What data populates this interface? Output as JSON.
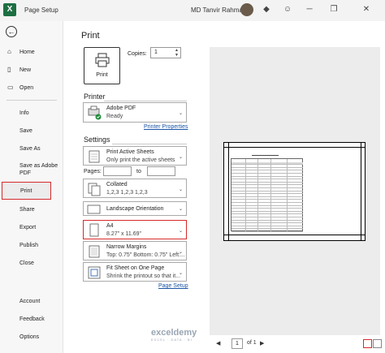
{
  "titlebar": {
    "app_icon": "X",
    "title": "Page Setup",
    "user": "MD Tanvir Rahman"
  },
  "sidebar": {
    "back_icon": "back-arrow-icon",
    "items": [
      {
        "label": "Home",
        "icon": "home-icon"
      },
      {
        "label": "New",
        "icon": "new-icon"
      },
      {
        "label": "Open",
        "icon": "open-folder-icon"
      },
      {
        "label": "Info"
      },
      {
        "label": "Save"
      },
      {
        "label": "Save As"
      },
      {
        "label": "Save as Adobe PDF"
      },
      {
        "label": "Print"
      },
      {
        "label": "Share"
      },
      {
        "label": "Export"
      },
      {
        "label": "Publish"
      },
      {
        "label": "Close"
      },
      {
        "label": "Account"
      },
      {
        "label": "Feedback"
      },
      {
        "label": "Options"
      }
    ],
    "active": "Print"
  },
  "main": {
    "heading": "Print",
    "print_button": "Print",
    "copies_label": "Copies:",
    "copies_value": "1",
    "printer_heading": "Printer",
    "printer_name": "Adobe PDF",
    "printer_status": "Ready",
    "printer_properties": "Printer Properties",
    "settings_heading": "Settings",
    "print_what": {
      "title": "Print Active Sheets",
      "subtitle": "Only print the active sheets"
    },
    "pages_label": "Pages:",
    "pages_to": "to",
    "collated": {
      "title": "Collated",
      "subtitle": "1,2,3    1,2,3    1,2,3"
    },
    "orientation": {
      "title": "Landscape Orientation"
    },
    "paper": {
      "title": "A4",
      "subtitle": "8.27\" x 11.69\""
    },
    "margins": {
      "title": "Narrow Margins",
      "subtitle": "Top: 0.75\" Bottom: 0.75\" Left:..."
    },
    "scaling": {
      "title": "Fit Sheet on One Page",
      "subtitle": "Shrink the printout so that it..."
    },
    "page_setup": "Page Setup"
  },
  "preview": {
    "current_page": "1",
    "of_label": "of 1"
  },
  "watermark": {
    "name": "exceldemy",
    "tagline": "EXCEL · DATA · BI"
  },
  "colors": {
    "highlight": "#d62a2a",
    "link": "#1a55a6",
    "excel_green": "#1d6f42"
  }
}
